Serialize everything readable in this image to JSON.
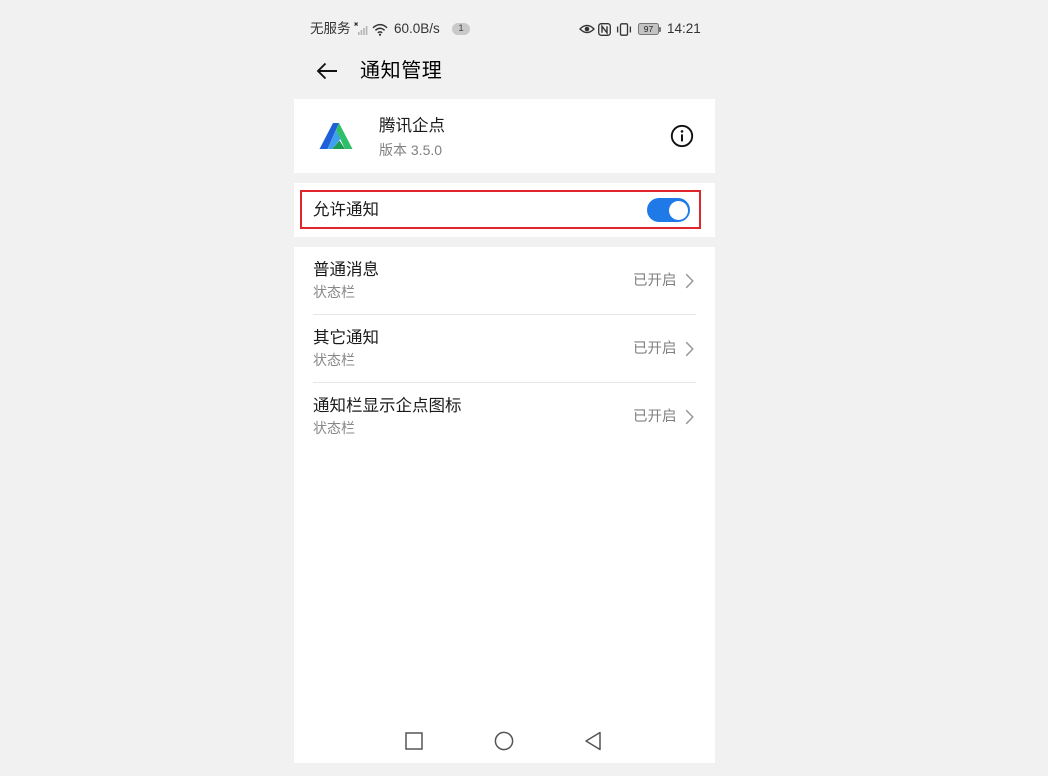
{
  "status_bar": {
    "carrier": "无服务",
    "net_speed": "60.0B/s",
    "notification_count": "1",
    "battery_level": "97",
    "time": "14:21"
  },
  "header": {
    "title": "通知管理"
  },
  "app_info": {
    "name": "腾讯企点",
    "version": "版本 3.5.0"
  },
  "allow_notifications": {
    "label": "允许通知",
    "enabled": true
  },
  "channels": [
    {
      "title": "普通消息",
      "subtitle": "状态栏",
      "status": "已开启"
    },
    {
      "title": "其它通知",
      "subtitle": "状态栏",
      "status": "已开启"
    },
    {
      "title": "通知栏显示企点图标",
      "subtitle": "状态栏",
      "status": "已开启"
    }
  ],
  "icons": {
    "status": [
      "signal-no-service-icon",
      "wifi-icon",
      "eye-icon",
      "nfc-icon",
      "vibrate-icon",
      "battery-icon"
    ],
    "header": "back-arrow-icon",
    "app": "tencent-qidian-logo",
    "info": "info-icon",
    "chevron": "chevron-right-icon",
    "nav": [
      "recent-apps-icon",
      "home-icon",
      "back-icon"
    ]
  },
  "colors": {
    "accent": "#1f7ae8",
    "highlight_border": "#e0262a",
    "background": "#f1f1f1",
    "card": "#ffffff"
  }
}
